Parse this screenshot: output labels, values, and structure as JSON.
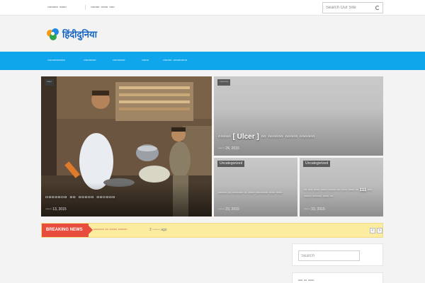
{
  "topbar": {
    "links": [
      "▫▫▫▫▫▫ ▫▫▫▫",
      "▫▫▫▫▫ ▫▫▫▫ ▫▫▫"
    ],
    "search_placeholder": "Search Our Site"
  },
  "logo": {
    "text": "हिंदीदुनिया"
  },
  "nav": {
    "items": [
      "▫▫▫▫▫▫▫▫▫▫",
      "▫▫▫▫▫▫▫",
      "▫▫▫▫▫▫▫",
      "▫▫▫▫",
      "▫▫▫▫▫ ▫▫▫▫▫▫▫▫"
    ]
  },
  "featured": [
    {
      "tag": "▫▫▫▫",
      "title": "▫▫▫▫▫▫▫ ▫▫ ▫▫▫▫▫ ▫▫▫▫▫▫",
      "date": "▫▫▫▫▫ 13, 2015"
    },
    {
      "tag": "▫▫▫▫▫▫▫",
      "title": "▫▫▫▫▫ [ Ulcer ] ▫▫ ▫▫▫▫▫▫ ▫▫▫▫▫ ▫▫▫▫▫▫",
      "date": "▫▫▫▫▫ 24, 2015"
    },
    {
      "tag": "Uncategorized",
      "title": "▫▫▫▫▫▫ ▫▫ ▫▫▫▫▫▫▫ ▫▫ ▫▫▫▫ ▫▫▫▫▫▫▫▫ ▫▫▫▫ ▫▫▫▫",
      "date": "▫▫▫▫▫ 23, 2015"
    },
    {
      "tag": "Uncategorized",
      "title": "▫▫ ▫▫▫ ▫▫▫▫ ▫▫▫▫ ▫▫▫▫▫ ▫▫ ▫▫▫▫ ▫▫▫▫ ▫▫ 111 ▫▫▫ ▫▫▫▫▫ ▫▫▫▫▫▫ ▫▫▫▫ ▫▫",
      "date": "▫▫▫▫▫ 23, 2015"
    }
  ],
  "ticker": {
    "label": "BREAKING NEWS",
    "text": "▫▫▫▫▫▫▫ ▫▫ ▫▫▫▫▫ ▫▫▫▫▫▫",
    "time": "2 ▫▫▫▫▫▫ ago"
  },
  "sidebar": {
    "search_placeholder": "Search",
    "widget_title": "▫▫▫ ▫▫ ▫▫▫▫"
  },
  "colors": {
    "nav": "#0fa6ec",
    "breaking": "#e74c3c",
    "ticker_bg": "#fbeca0"
  }
}
